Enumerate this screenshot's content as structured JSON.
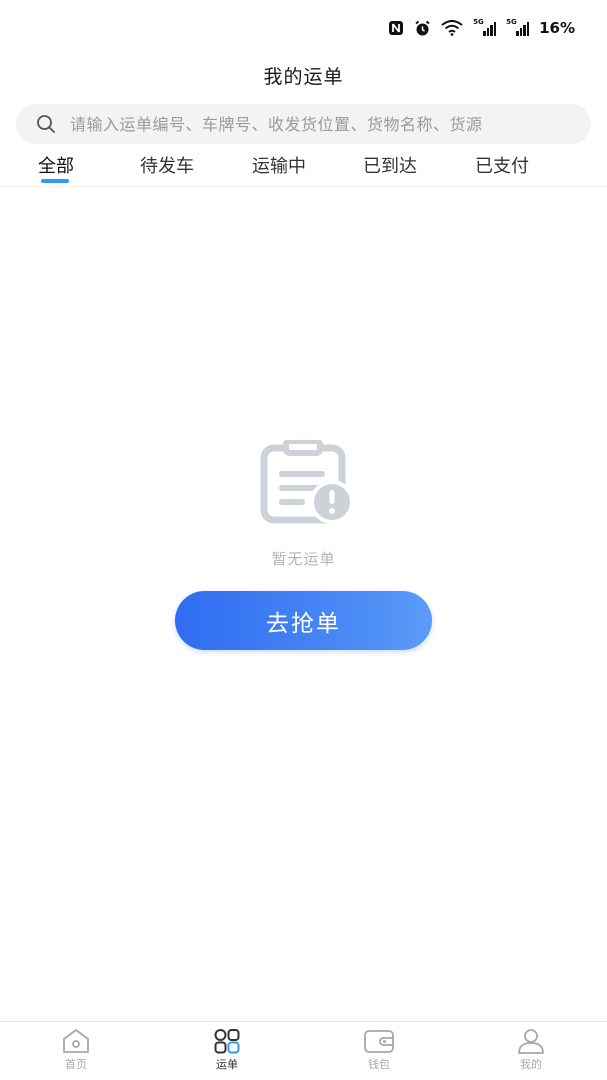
{
  "status_bar": {
    "nfc_icon": "nfc-icon",
    "alarm_icon": "alarm-icon",
    "wifi_icon": "wifi-icon",
    "signal_tag_1": "5G",
    "signal_tag_2": "5G",
    "battery": "16%"
  },
  "header": {
    "title": "我的运单"
  },
  "search": {
    "placeholder": "请输入运单编号、车牌号、收发货位置、货物名称、货源",
    "icon": "search-icon"
  },
  "tabs": [
    {
      "label": "全部",
      "active": true
    },
    {
      "label": "待发车",
      "active": false
    },
    {
      "label": "运输中",
      "active": false
    },
    {
      "label": "已到达",
      "active": false
    },
    {
      "label": "已支付",
      "active": false
    }
  ],
  "empty_state": {
    "icon": "clipboard-warning-icon",
    "text": "暂无运单",
    "button_label": "去抢单"
  },
  "bottom_nav": [
    {
      "label": "首页",
      "icon": "home-icon",
      "active": false
    },
    {
      "label": "运单",
      "icon": "waybill-grid-icon",
      "active": true
    },
    {
      "label": "钱包",
      "icon": "wallet-icon",
      "active": false
    },
    {
      "label": "我的",
      "icon": "profile-icon",
      "active": false
    }
  ],
  "colors": {
    "accent": "#2f6cf0",
    "tab_indicator": "#2f9cf0",
    "empty_icon": "#cdd2d9",
    "muted_text": "#b4b4b4"
  }
}
